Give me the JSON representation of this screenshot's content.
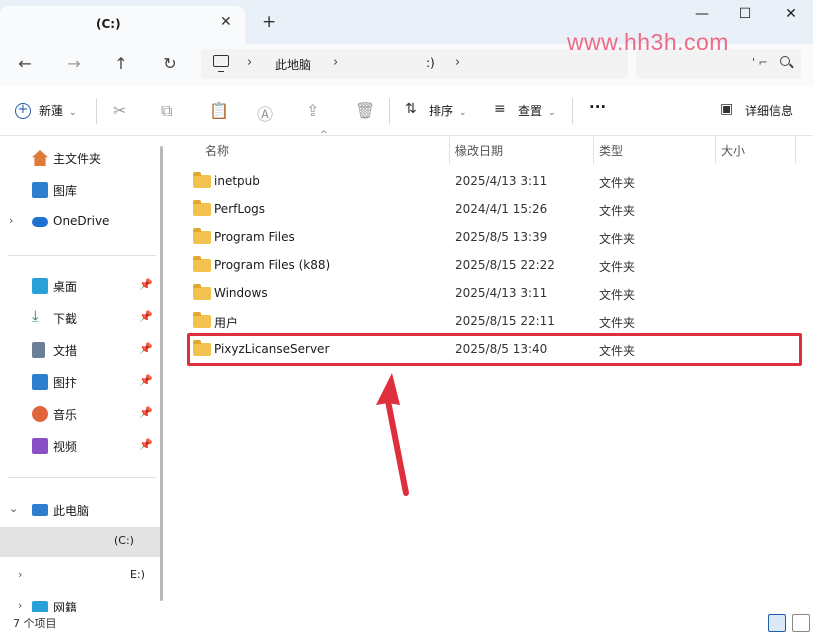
{
  "window": {
    "tab_title": "(C:)",
    "tab_close": "✕",
    "new_tab": "+",
    "minimize": "—",
    "maximize": "☐",
    "close": "✕"
  },
  "nav": {
    "back": "←",
    "forward": "→",
    "up": "↑",
    "refresh": "↻",
    "breadcrumb": [
      "此地脑",
      ":)"
    ],
    "search_text": "' ⌐"
  },
  "watermark": "www.hh3h.com",
  "toolbar": {
    "new_label": "新蓮",
    "sort_label": "排序",
    "view_label": "查置",
    "more_label": "···",
    "details_label": "详细信息"
  },
  "sidebar": {
    "items": [
      {
        "label": "主文件夹",
        "icon": "home-icon"
      },
      {
        "label": "图库",
        "icon": "gallery-icon"
      },
      {
        "label": "OneDrive",
        "icon": "cloud-icon"
      },
      {
        "label": "桌面",
        "icon": "desktop-icon"
      },
      {
        "label": "下截",
        "icon": "download-icon"
      },
      {
        "label": "文措",
        "icon": "document-icon"
      },
      {
        "label": "图抃",
        "icon": "picture-icon"
      },
      {
        "label": "音乐",
        "icon": "music-icon"
      },
      {
        "label": "视频",
        "icon": "video-icon"
      },
      {
        "label": "此电脑",
        "icon": "pc-icon"
      },
      {
        "label": "(C:)",
        "icon": "drive-icon"
      },
      {
        "label": "E:)",
        "icon": "drive-icon"
      },
      {
        "label": "网籍",
        "icon": "network-icon"
      }
    ],
    "pin_glyph": "📌"
  },
  "columns": {
    "name": "名称",
    "date": "椽改日期",
    "type": "类型",
    "size": "大小"
  },
  "files": [
    {
      "name": "inetpub",
      "date": "2025/4/13 3:11",
      "type": "文件夹"
    },
    {
      "name": "PerfLogs",
      "date": "2024/4/1 15:26",
      "type": "文件夹"
    },
    {
      "name": "Program Files",
      "date": "2025/8/5 13:39",
      "type": "文件夹"
    },
    {
      "name": "Program Files (k88)",
      "date": "2025/8/15 22:22",
      "type": "文件夹"
    },
    {
      "name": "Windows",
      "date": "2025/4/13 3:11",
      "type": "文件夹"
    },
    {
      "name": "用户",
      "date": "2025/8/15 22:11",
      "type": "文件夹"
    },
    {
      "name": "PixyzLicanseServer",
      "date": "2025/8/5 13:40",
      "type": "文件夹"
    }
  ],
  "status": {
    "item_count": "7 个项目"
  },
  "colors": {
    "highlight": "#e02f3c",
    "arrow": "#e02f3c",
    "folder": "#f2c14e",
    "watermark": "#ee6a85"
  }
}
